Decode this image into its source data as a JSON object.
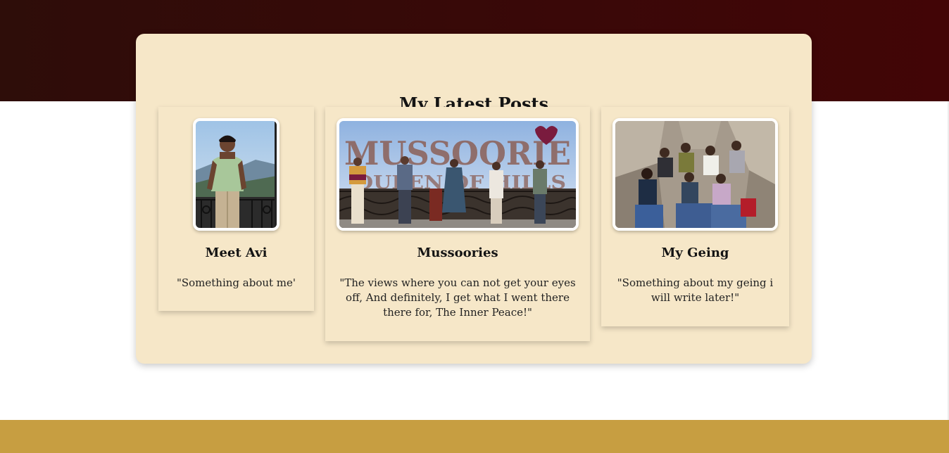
{
  "section": {
    "title": "My Latest Posts"
  },
  "posts": [
    {
      "title": "Meet Avi",
      "excerpt": "\"Something about me'",
      "image_icon": "portrait-photo"
    },
    {
      "title": "Mussoories",
      "excerpt": "\"The views where you can not get your eyes off, And definitely, I get what I went there there for, The Inner Peace!\"",
      "image_icon": "group-sign-photo",
      "image_sign_text": "MUSSOORIE",
      "image_sign_subtext": "QUEEN OF HILLS"
    },
    {
      "title": "My Geing",
      "excerpt": "\"Something about my geing i will write later!\"",
      "image_icon": "group-rocks-photo"
    }
  ],
  "colors": {
    "header": "#3a0808",
    "panel": "#f6e7c8",
    "footer": "#c79e41"
  }
}
